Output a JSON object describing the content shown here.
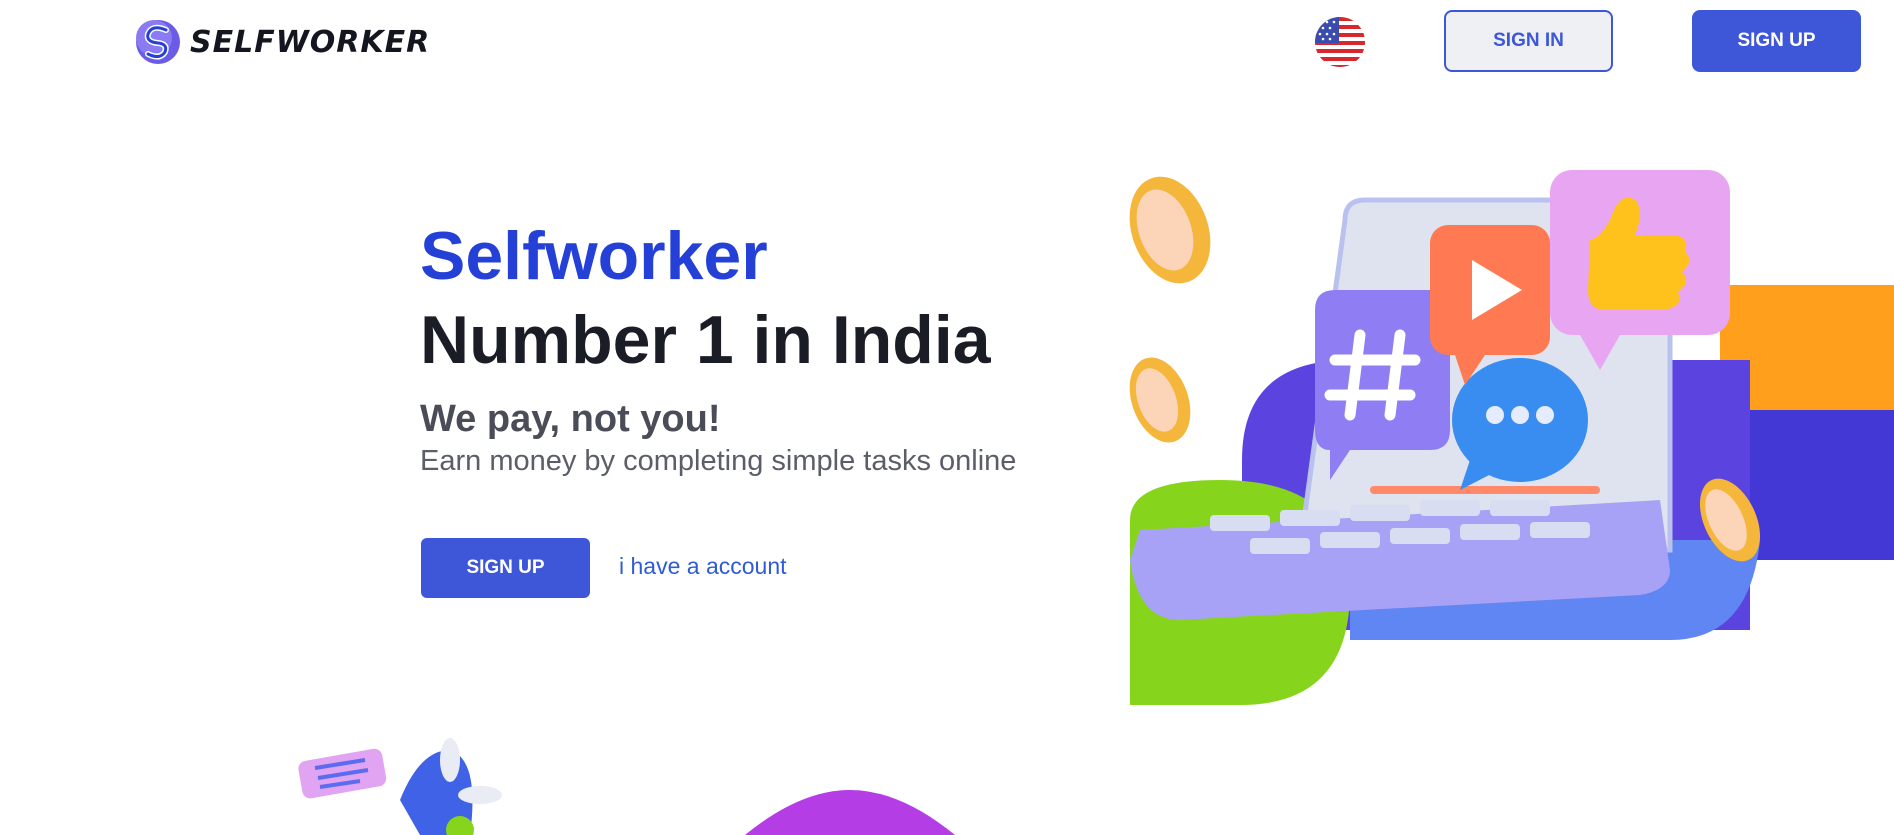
{
  "header": {
    "logo_text": "SELFWORKER",
    "language_icon": "us-flag-icon",
    "sign_in_label": "SIGN IN",
    "sign_up_label": "SIGN UP"
  },
  "hero": {
    "brand": "Selfworker",
    "headline": "Number 1 in India",
    "tagline": "We pay, not you!",
    "subtitle": "Earn money by completing simple tasks online",
    "signup_label": "SIGN UP",
    "account_link": "i have a account"
  },
  "colors": {
    "accent": "#3d57d8",
    "brand_blue": "#2440d6",
    "heading": "#1b1d26",
    "link": "#2f5bd6"
  }
}
